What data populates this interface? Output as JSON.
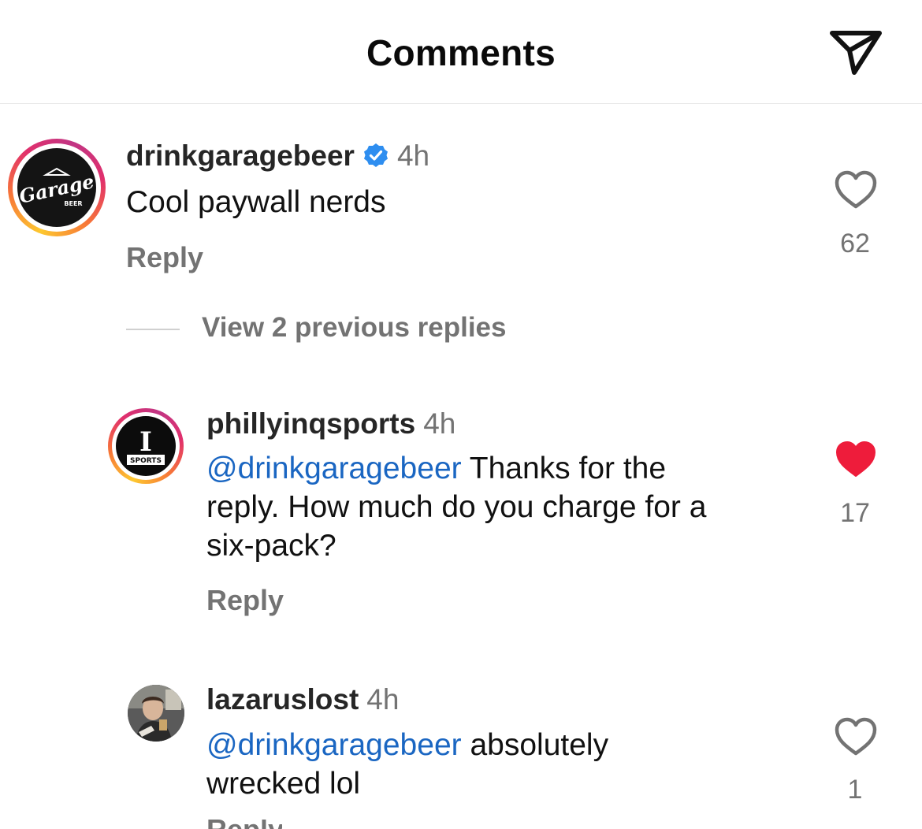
{
  "header": {
    "title": "Comments",
    "send_icon": "paper-plane-icon"
  },
  "colors": {
    "like_active": "#ee1c3b",
    "mention": "#1a66c2",
    "verified": "#2e8ef0",
    "muted": "#737373"
  },
  "comments": [
    {
      "username": "drinkgaragebeer",
      "verified": true,
      "time": "4h",
      "text": "Cool paywall nerds",
      "reply_label": "Reply",
      "likes": "62",
      "liked": false,
      "avatar": {
        "logo_text": "Garage",
        "sub_text": "BEER"
      }
    },
    {
      "username": "phillyinqsports",
      "verified": false,
      "time": "4h",
      "mention": "@drinkgaragebeer",
      "text_line1_rest": " Thanks for the",
      "text_line2": "reply. How much do you charge for a",
      "text_line3": "six-pack?",
      "reply_label": "Reply",
      "likes": "17",
      "liked": true,
      "avatar": {
        "logo_text": "I",
        "sub_text": "SPORTS"
      }
    },
    {
      "username": "lazaruslost",
      "verified": false,
      "time": "4h",
      "mention": "@drinkgaragebeer",
      "text_line1_rest": " absolutely",
      "text_line2": "wrecked lol",
      "reply_label": "Reply",
      "likes": "1",
      "liked": false
    }
  ],
  "view_replies": "View 2 previous replies"
}
